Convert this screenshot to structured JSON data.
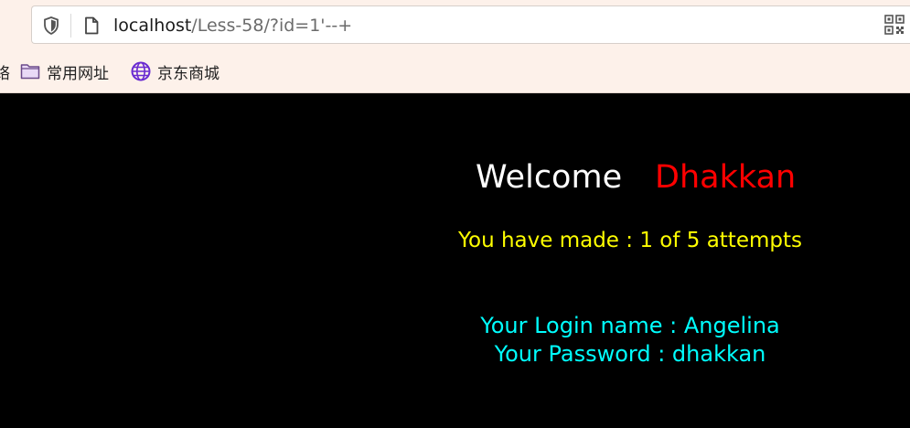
{
  "browser": {
    "url_host": "localhost",
    "url_path": "/Less-58/?id=1'--+",
    "bookmarks": {
      "partial_label": "络",
      "folder_label": "常用网址",
      "jd_label": "京东商城"
    }
  },
  "page": {
    "welcome_label": "Welcome",
    "username": "Dhakkan",
    "attempts_text": "You have made : 1 of 5 attempts",
    "login_text": "Your Login name : Angelina",
    "password_text": "Your Password : dhakkan"
  },
  "colors": {
    "background": "#000000",
    "welcome": "#ffffff",
    "username": "#ff0000",
    "attempts": "#ffff00",
    "credentials": "#00ffff",
    "chrome": "#fdf1ea"
  }
}
